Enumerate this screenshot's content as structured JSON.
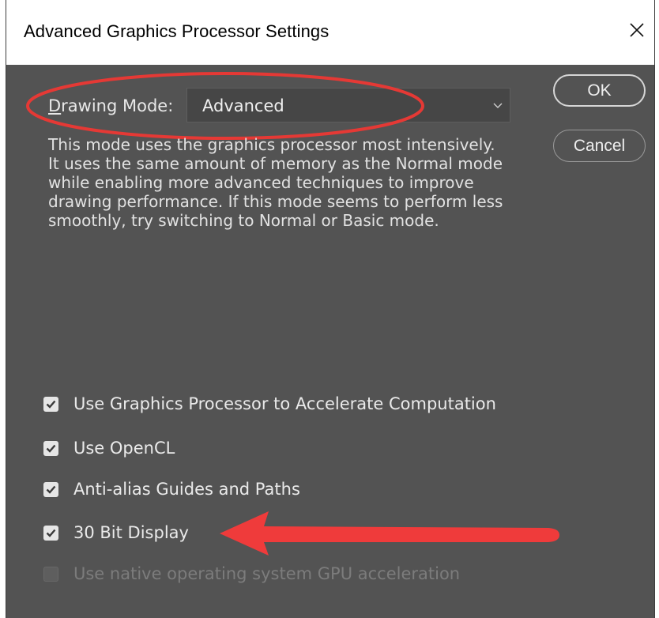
{
  "dialog": {
    "title": "Advanced Graphics Processor Settings",
    "close_icon": "close-icon"
  },
  "drawing_mode": {
    "label_accel": "D",
    "label_rest": "rawing Mode:",
    "selected": "Advanced",
    "description": "This mode uses the graphics processor most intensively.  It uses the same amount of memory as the Normal mode while enabling more advanced techniques to improve drawing performance.  If this mode seems to perform less smoothly, try switching to Normal or Basic mode."
  },
  "buttons": {
    "ok": "OK",
    "cancel": "Cancel"
  },
  "options": [
    {
      "label": "Use Graphics Processor to Accelerate Computation",
      "checked": true,
      "enabled": true
    },
    {
      "label": "Use OpenCL",
      "checked": true,
      "enabled": true
    },
    {
      "label": "Anti-alias Guides and Paths",
      "checked": true,
      "enabled": true
    },
    {
      "label": "30 Bit Display",
      "checked": true,
      "enabled": true
    },
    {
      "label": "Use native operating system GPU acceleration",
      "checked": false,
      "enabled": false
    }
  ],
  "annotations": {
    "ellipse_color": "#e53935",
    "arrow_color": "#ef3b3b"
  },
  "colors": {
    "dialog_bg": "#535353",
    "titlebar_bg": "#ffffff",
    "text": "#e8e8e8",
    "checkbox_fill": "#e6e6e6",
    "checkmark": "#3a3a3a"
  }
}
